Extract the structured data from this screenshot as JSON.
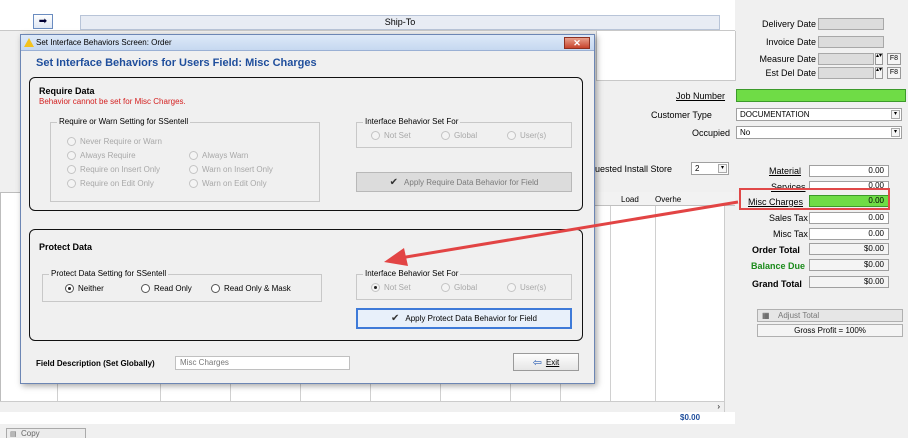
{
  "background": {
    "nav_arrow": "➡",
    "shipto_header": "Ship-To",
    "right_panel": {
      "delivery_date": "Delivery Date",
      "invoice_date": "Invoice Date",
      "measure_date": "Measure Date",
      "est_del_date": "Est Del Date",
      "f8": "F8",
      "job_number": "Job Number",
      "customer_type_label": "Customer Type",
      "customer_type_value": "DOCUMENTATION",
      "occupied_label": "Occupied",
      "occupied_value": "No",
      "install_store_label": "uested Install Store",
      "install_store_value": "2",
      "material": {
        "label": "Material",
        "value": "0.00"
      },
      "services": {
        "label": "Services",
        "value": "0.00"
      },
      "misc_charges": {
        "label": "Misc Charges",
        "value": "0.00"
      },
      "sales_tax": {
        "label": "Sales Tax",
        "value": "0.00"
      },
      "misc_tax": {
        "label": "Misc Tax",
        "value": "0.00"
      },
      "order_total": {
        "label": "Order Total",
        "value": "$0.00"
      },
      "balance_due": {
        "label": "Balance Due",
        "value": "$0.00"
      },
      "grand_total": {
        "label": "Grand Total",
        "value": "$0.00"
      },
      "adjust_total": "Adjust Total",
      "gross_profit": "Gross Profit = 100%"
    },
    "grid": {
      "col_load": "Load",
      "col_overhead": "Overhe",
      "total": "$0.00"
    },
    "copy_button": "Copy"
  },
  "dialog": {
    "title": "Set Interface Behaviors   Screen: Order",
    "close_label": "✕",
    "heading": "Set Interface Behaviors for Users    Field:  Misc Charges",
    "require": {
      "title": "Require Data",
      "error": "Behavior cannot be set for Misc Charges.",
      "setting_legend": "Require or Warn Setting for SSentell",
      "options": {
        "never": "Never Require or Warn",
        "always_require": "Always Require",
        "always_warn": "Always Warn",
        "require_insert": "Require on Insert Only",
        "warn_insert": "Warn on Insert Only",
        "require_edit": "Require on Edit Only",
        "warn_edit": "Warn on Edit Only"
      },
      "behavior_legend": "Interface Behavior Set For",
      "behavior": {
        "not_set": "Not Set",
        "global": "Global",
        "users": "User(s)"
      },
      "apply_label": "Apply Require Data Behavior for Field"
    },
    "protect": {
      "title": "Protect Data",
      "setting_legend": "Protect Data Setting for SSentell",
      "options": {
        "neither": "Neither",
        "read_only": "Read Only",
        "read_only_mask": "Read Only & Mask"
      },
      "behavior_legend": "Interface Behavior Set For",
      "behavior": {
        "not_set": "Not Set",
        "global": "Global",
        "users": "User(s)"
      },
      "apply_label": "Apply Protect Data Behavior for Field"
    },
    "field_description_label": "Field Description (Set Globally)",
    "field_description_value": "Misc Charges",
    "exit_label": "Exit"
  },
  "colors": {
    "accent_blue": "#1f4e9c",
    "error_red": "#d41f1f",
    "highlight_red": "#e04848",
    "job_green": "#6fdc46",
    "balance_green": "#1a8a1a"
  }
}
